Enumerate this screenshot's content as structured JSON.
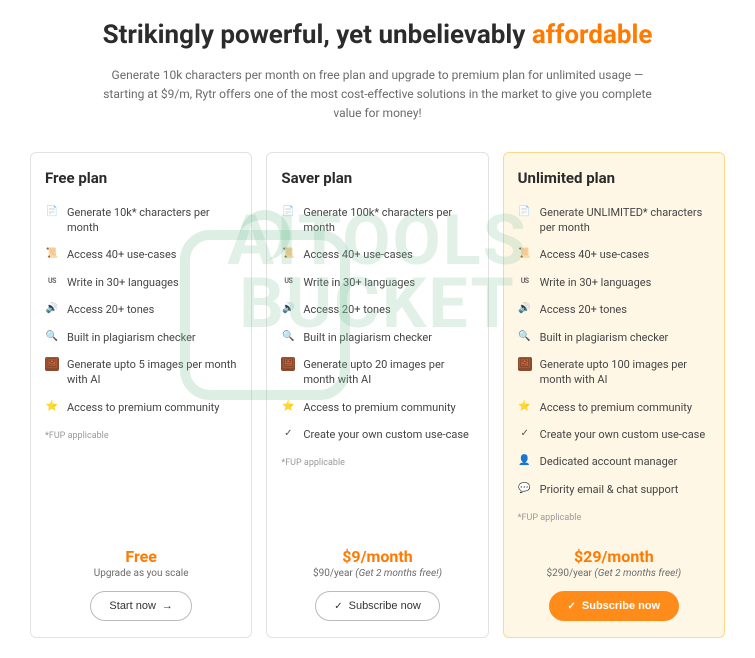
{
  "hero": {
    "title_a": "Strikingly powerful, yet unbelievably ",
    "title_b": "affordable",
    "sub": "Generate 10k characters per month on free plan and upgrade to premium plan for unlimited usage — starting at $9/m, Rytr offers one of the most cost-effective solutions in the market to give you complete value for money!"
  },
  "watermark": {
    "line1": "AITOOLS",
    "line2": "BUCKET"
  },
  "plans": [
    {
      "name": "Free plan",
      "features": [
        {
          "icon": "doc",
          "text": "Generate 10k* characters per month"
        },
        {
          "icon": "scroll",
          "text": "Access 40+ use-cases"
        },
        {
          "icon": "us",
          "text": "Write in 30+ languages"
        },
        {
          "icon": "sound",
          "text": "Access 20+ tones"
        },
        {
          "icon": "mag",
          "text": "Built in plagiarism checker"
        },
        {
          "icon": "img",
          "text": "Generate upto 5 images per month with AI"
        },
        {
          "icon": "star",
          "text": "Access to premium community"
        }
      ],
      "fup": "*FUP applicable",
      "price": "Free",
      "price_sub": "Upgrade as you scale",
      "cta": "Start now",
      "cta_style": "outline-arrow"
    },
    {
      "name": "Saver plan",
      "features": [
        {
          "icon": "doc",
          "text": "Generate 100k* characters per month"
        },
        {
          "icon": "scroll",
          "text": "Access 40+ use-cases"
        },
        {
          "icon": "us",
          "text": "Write in 30+ languages"
        },
        {
          "icon": "sound",
          "text": "Access 20+ tones"
        },
        {
          "icon": "mag",
          "text": "Built in plagiarism checker"
        },
        {
          "icon": "img",
          "text": "Generate upto 20 images per month with AI"
        },
        {
          "icon": "star",
          "text": "Access to premium community"
        },
        {
          "icon": "check",
          "text": "Create your own custom use-case"
        }
      ],
      "fup": "*FUP applicable",
      "price": "$9/month",
      "price_sub_a": "$90/year ",
      "price_sub_b": "(Get 2 months free!)",
      "cta": "Subscribe now",
      "cta_style": "outline-check"
    },
    {
      "name": "Unlimited plan",
      "highlight": true,
      "features": [
        {
          "icon": "doc",
          "text": "Generate UNLIMITED* characters per month"
        },
        {
          "icon": "scroll",
          "text": "Access 40+ use-cases"
        },
        {
          "icon": "us",
          "text": "Write in 30+ languages"
        },
        {
          "icon": "sound",
          "text": "Access 20+ tones"
        },
        {
          "icon": "mag",
          "text": "Built in plagiarism checker"
        },
        {
          "icon": "img",
          "text": "Generate upto 100 images per month with AI"
        },
        {
          "icon": "star",
          "text": "Access to premium community"
        },
        {
          "icon": "check",
          "text": "Create your own custom use-case"
        },
        {
          "icon": "person",
          "text": "Dedicated account manager"
        },
        {
          "icon": "chat",
          "text": "Priority email & chat support"
        }
      ],
      "fup": "*FUP applicable",
      "price": "$29/month",
      "price_sub_a": "$290/year ",
      "price_sub_b": "(Get 2 months free!)",
      "cta": "Subscribe now",
      "cta_style": "primary-check"
    }
  ]
}
